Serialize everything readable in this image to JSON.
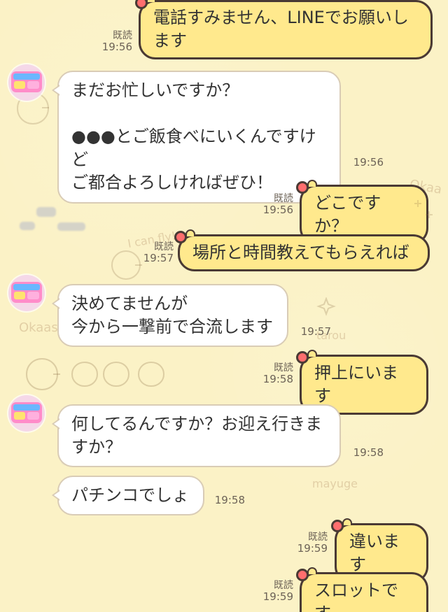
{
  "messages": [
    {
      "id": "m1",
      "text": "電話すみません、LINEでお願いします",
      "read": "既読",
      "time": "19:56"
    },
    {
      "id": "m2",
      "text": "まだお忙しいですか？\n\n●●●とご飯食べにいくんですけど\nご都合よろしければぜひ！",
      "time": "19:56"
    },
    {
      "id": "m3",
      "text": "どこですか？",
      "read": "既読",
      "time": "19:56"
    },
    {
      "id": "m4",
      "text": "場所と時間教えてもらえれば",
      "read": "既読",
      "time": "19:57"
    },
    {
      "id": "m5",
      "text": "決めてませんが\n今から一撃前で合流します",
      "time": "19:57"
    },
    {
      "id": "m6",
      "text": "押上にいます",
      "read": "既読",
      "time": "19:58"
    },
    {
      "id": "m7",
      "text": "何してるんですか？お迎え行きますか？",
      "time": "19:58"
    },
    {
      "id": "m8",
      "text": "パチンコでしょ",
      "time": "19:58"
    },
    {
      "id": "m9",
      "text": "違います",
      "read": "既読",
      "time": "19:59"
    },
    {
      "id": "m10",
      "text": "スロットです",
      "read": "既読",
      "time": "19:59"
    }
  ],
  "doodles": {
    "shichisan": "shichisan",
    "okaa": "Okaa",
    "icanfly": "I can fly!",
    "okaasa": "Okaasa",
    "mayuge": "mayuge",
    "tarou": "tarou"
  }
}
